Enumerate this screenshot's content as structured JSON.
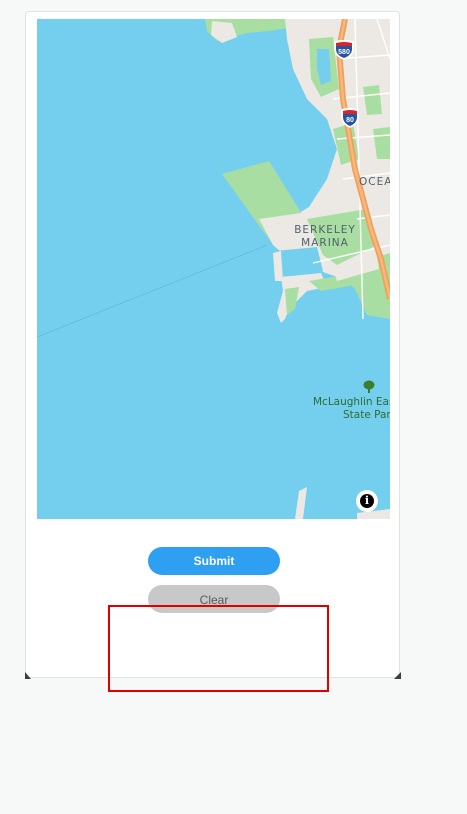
{
  "map": {
    "labels": {
      "marina_line1": "BERKELEY",
      "marina_line2": "MARINA",
      "ocean_partial": "OCEA",
      "park_line1": "McLaughlin Eas",
      "park_line2": "State Par"
    },
    "highway_shields": [
      "580",
      "80"
    ],
    "info_icon": "i",
    "colors": {
      "water": "#74cfef",
      "park": "#a8dea1",
      "land": "#ece9e4",
      "highway": "#f0a05a"
    }
  },
  "buttons": {
    "submit_label": "Submit",
    "clear_label": "Clear"
  },
  "colors": {
    "submit": "#2e9ff1",
    "clear": "#c8c8c8",
    "highlight": "#e00000"
  }
}
